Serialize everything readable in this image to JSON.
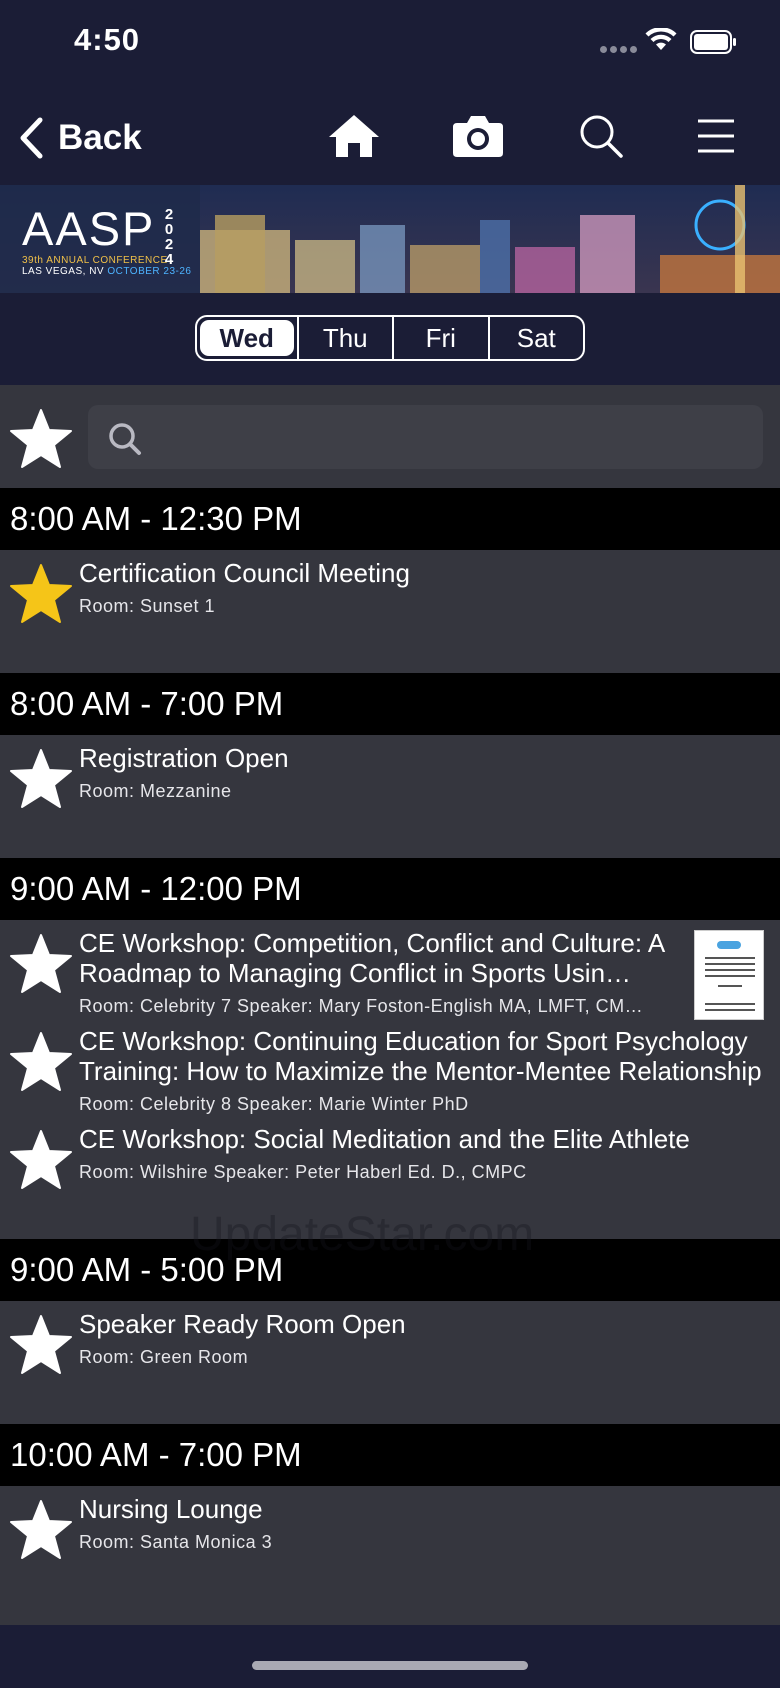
{
  "status_bar": {
    "time": "4:50"
  },
  "nav": {
    "back_label": "Back"
  },
  "banner": {
    "logo_main": "AASP",
    "logo_year": "2024",
    "conference": "39th ANNUAL CONFERENCE",
    "location": "LAS VEGAS, NV",
    "dates": "OCTOBER 23-26"
  },
  "day_tabs": [
    {
      "label": "Wed",
      "active": true
    },
    {
      "label": "Thu",
      "active": false
    },
    {
      "label": "Fri",
      "active": false
    },
    {
      "label": "Sat",
      "active": false
    }
  ],
  "search": {
    "value": "",
    "placeholder": ""
  },
  "sections": [
    {
      "time": "8:00 AM - 12:30 PM",
      "events": [
        {
          "title": "Certification Council Meeting",
          "meta": "Room: Sunset 1",
          "favorited": true
        }
      ]
    },
    {
      "time": "8:00 AM - 7:00 PM",
      "events": [
        {
          "title": "Registration Open",
          "meta": "Room: Mezzanine",
          "favorited": false
        }
      ]
    },
    {
      "time": "9:00 AM - 12:00 PM",
      "events": [
        {
          "title": "CE Workshop: Competition, Conflict and Culture: A Roadmap to Managing Conflict in Sports Usin…",
          "meta": "Room: Celebrity 7 Speaker: Mary Foston-English MA, LMFT, CM…",
          "favorited": false,
          "thumbnail": true
        },
        {
          "title": "CE Workshop: Continuing Education for Sport Psychology Training: How to Maximize the Mentor-Mentee Relationship",
          "meta": "Room: Celebrity 8 Speaker: Marie Winter PhD",
          "favorited": false
        },
        {
          "title": "CE Workshop: Social Meditation and the Elite Athlete",
          "meta": "Room: Wilshire Speaker: Peter Haberl Ed. D., CMPC",
          "favorited": false
        }
      ]
    },
    {
      "time": "9:00 AM - 5:00 PM",
      "events": [
        {
          "title": "Speaker Ready Room Open",
          "meta": "Room: Green Room",
          "favorited": false
        }
      ]
    },
    {
      "time": "10:00 AM - 7:00 PM",
      "events": [
        {
          "title": "Nursing Lounge",
          "meta": "Room: Santa Monica 3",
          "favorited": false
        }
      ]
    }
  ],
  "watermark": "UpdateStar.com",
  "colors": {
    "background": "#1b1d36",
    "list_background": "#35363e",
    "section_header": "#000000",
    "favorite_star": "#f5c518",
    "star_outline": "#ffffff"
  },
  "icons": [
    "wifi-icon",
    "battery-icon",
    "chevron-left-icon",
    "home-icon",
    "camera-icon",
    "search-icon",
    "menu-icon",
    "star-icon"
  ]
}
